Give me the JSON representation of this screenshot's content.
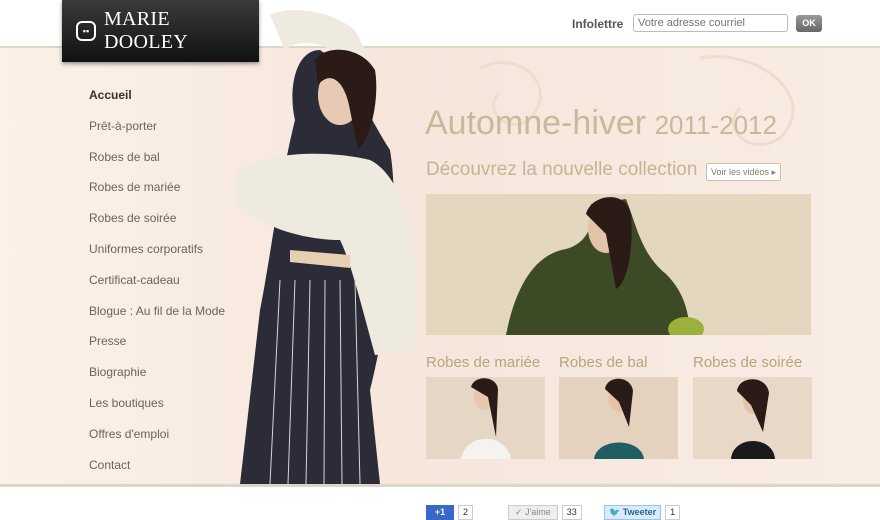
{
  "brand": {
    "name": "MARIE DOOLEY"
  },
  "newsletter": {
    "label": "Infolettre",
    "placeholder": "Votre adresse courriel",
    "button": "OK"
  },
  "nav": {
    "items": [
      {
        "label": "Accueil",
        "active": true
      },
      {
        "label": "Prêt-à-porter"
      },
      {
        "label": "Robes de bal"
      },
      {
        "label": "Robes de mariée"
      },
      {
        "label": "Robes de soirée"
      },
      {
        "label": "Uniformes corporatifs"
      },
      {
        "label": "Certificat-cadeau"
      },
      {
        "label": "Blogue : Au fil de la Mode"
      },
      {
        "label": "Presse"
      },
      {
        "label": "Biographie"
      },
      {
        "label": "Les boutiques"
      },
      {
        "label": "Offres d'emploi"
      },
      {
        "label": "Contact"
      }
    ]
  },
  "hero": {
    "season": "Automne-hiver",
    "years": "2011-2012",
    "subtitle": "Découvrez la nouvelle collection",
    "videos_button": "Voir les vidéos"
  },
  "categories": [
    {
      "title": "Robes de mariée"
    },
    {
      "title": "Robes de bal"
    },
    {
      "title": "Robes de soirée"
    }
  ],
  "social": {
    "gplus_label": "+1",
    "gplus_count": "2",
    "like_label": "J'aime",
    "like_count": "33",
    "tweet_label": "Tweeter",
    "tweet_count": "1"
  },
  "colors": {
    "accent": "#c9b99a",
    "background": "#f6e6dc"
  }
}
